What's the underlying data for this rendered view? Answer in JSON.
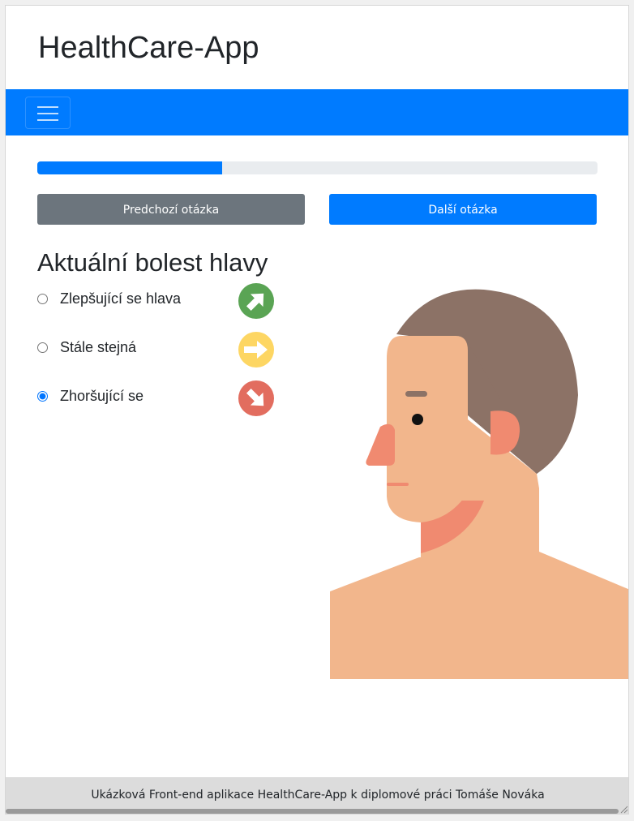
{
  "app": {
    "title": "HealthCare-App"
  },
  "navbar": {
    "toggler_icon": "hamburger-icon",
    "color": "#007bff"
  },
  "progress": {
    "percent": 33
  },
  "buttons": {
    "prev_label": "Predchozí otázka",
    "next_label": "Další otázka"
  },
  "question": {
    "title": "Aktuální bolest hlavy",
    "options": [
      {
        "label": "Zlepšující se hlava",
        "checked": false,
        "icon": "arrow-up-right-icon",
        "color": "#5aa454"
      },
      {
        "label": "Stále stejná",
        "checked": false,
        "icon": "arrow-right-icon",
        "color": "#fdd663"
      },
      {
        "label": "Zhoršující se",
        "checked": true,
        "icon": "arrow-down-right-icon",
        "color": "#e26d5f"
      }
    ]
  },
  "illustration": {
    "icon": "head-profile-illustration"
  },
  "footer": {
    "text": "Ukázková Front-end aplikace HealthCare-App k diplomové práci Tomáše Nováka"
  }
}
